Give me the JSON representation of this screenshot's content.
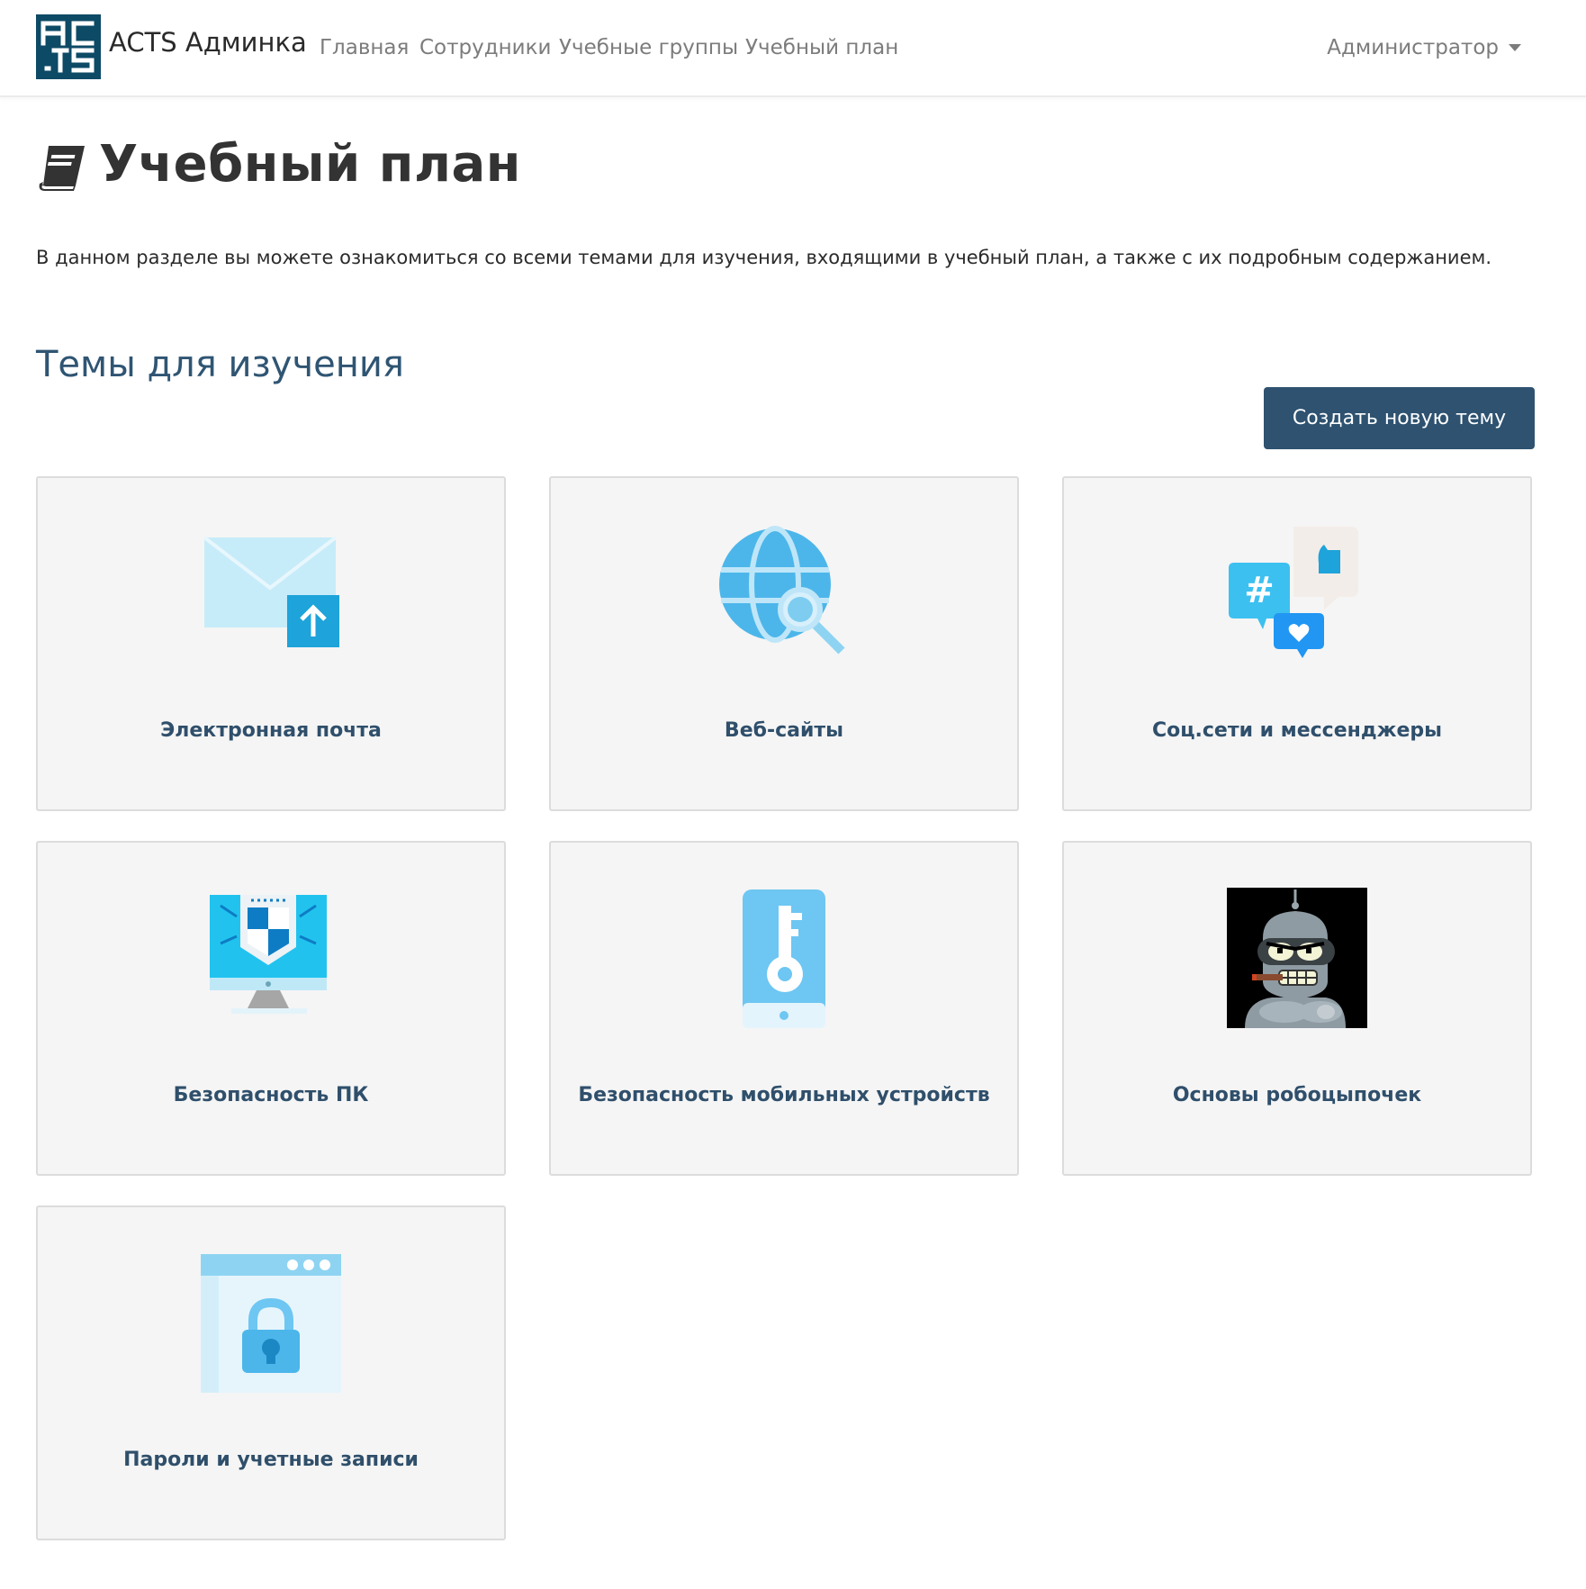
{
  "navbar": {
    "logo_text": "ACTS",
    "brand": "ACTS Админка",
    "links": [
      "Главная",
      "Сотрудники",
      "Учебные группы",
      "Учебный план"
    ],
    "user_menu": "Администратор"
  },
  "page": {
    "title": "Учебный план",
    "intro": "В данном разделе вы можете ознакомиться со всеми темами для изучения, входящими в учебный план, а также с их подробным содержанием.",
    "section_title": "Темы для изучения",
    "create_button": "Создать новую тему"
  },
  "topics": [
    {
      "title": "Электронная почта",
      "icon": "email-upload-icon"
    },
    {
      "title": "Веб-сайты",
      "icon": "globe-search-icon"
    },
    {
      "title": "Соц.сети и мессенджеры",
      "icon": "social-chat-icon"
    },
    {
      "title": "Безопасность ПК",
      "icon": "monitor-shield-icon"
    },
    {
      "title": "Безопасность мобильных устройств",
      "icon": "phone-key-icon"
    },
    {
      "title": "Основы робоцыпочек",
      "icon": "robot-image"
    },
    {
      "title": "Пароли и учетные записи",
      "icon": "browser-lock-icon"
    }
  ],
  "colors": {
    "primary": "#2e5270",
    "logo": "#0d4a66",
    "card_bg": "#f5f5f5",
    "card_title": "#2f4f6b",
    "section_title": "#2f5573"
  }
}
